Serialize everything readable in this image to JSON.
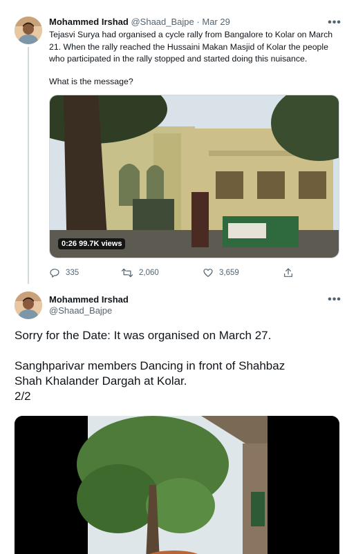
{
  "tweet1": {
    "display_name": "Mohammed Irshad",
    "handle": "@Shaad_Bajpe",
    "separator": "·",
    "date": "Mar 29",
    "text": "Tejasvi Surya had organised a cycle rally from Bangalore to Kolar on March 21. When the rally reached the Hussaini Makan Masjid of Kolar the people who participated in the rally stopped and started doing this nuisance.",
    "question": "What is the message?",
    "video": {
      "duration": "0:26",
      "views": "99.7K views"
    },
    "replies": "335",
    "retweets": "2,060",
    "likes": "3,659",
    "more": "•••"
  },
  "tweet2": {
    "display_name": "Mohammed Irshad",
    "handle": "@Shaad_Bajpe",
    "more": "•••",
    "line1": "Sorry for the Date: It was organised on March 27.",
    "line2": "Sanghparivar members Dancing in front of Shahbaz",
    "line3": "Shah Khalander Dargah at Kolar.",
    "line4": "2/2"
  },
  "colors": {
    "secondary_text": "#536471",
    "primary_text": "#0f1419",
    "thread_line": "#cfd9de"
  }
}
